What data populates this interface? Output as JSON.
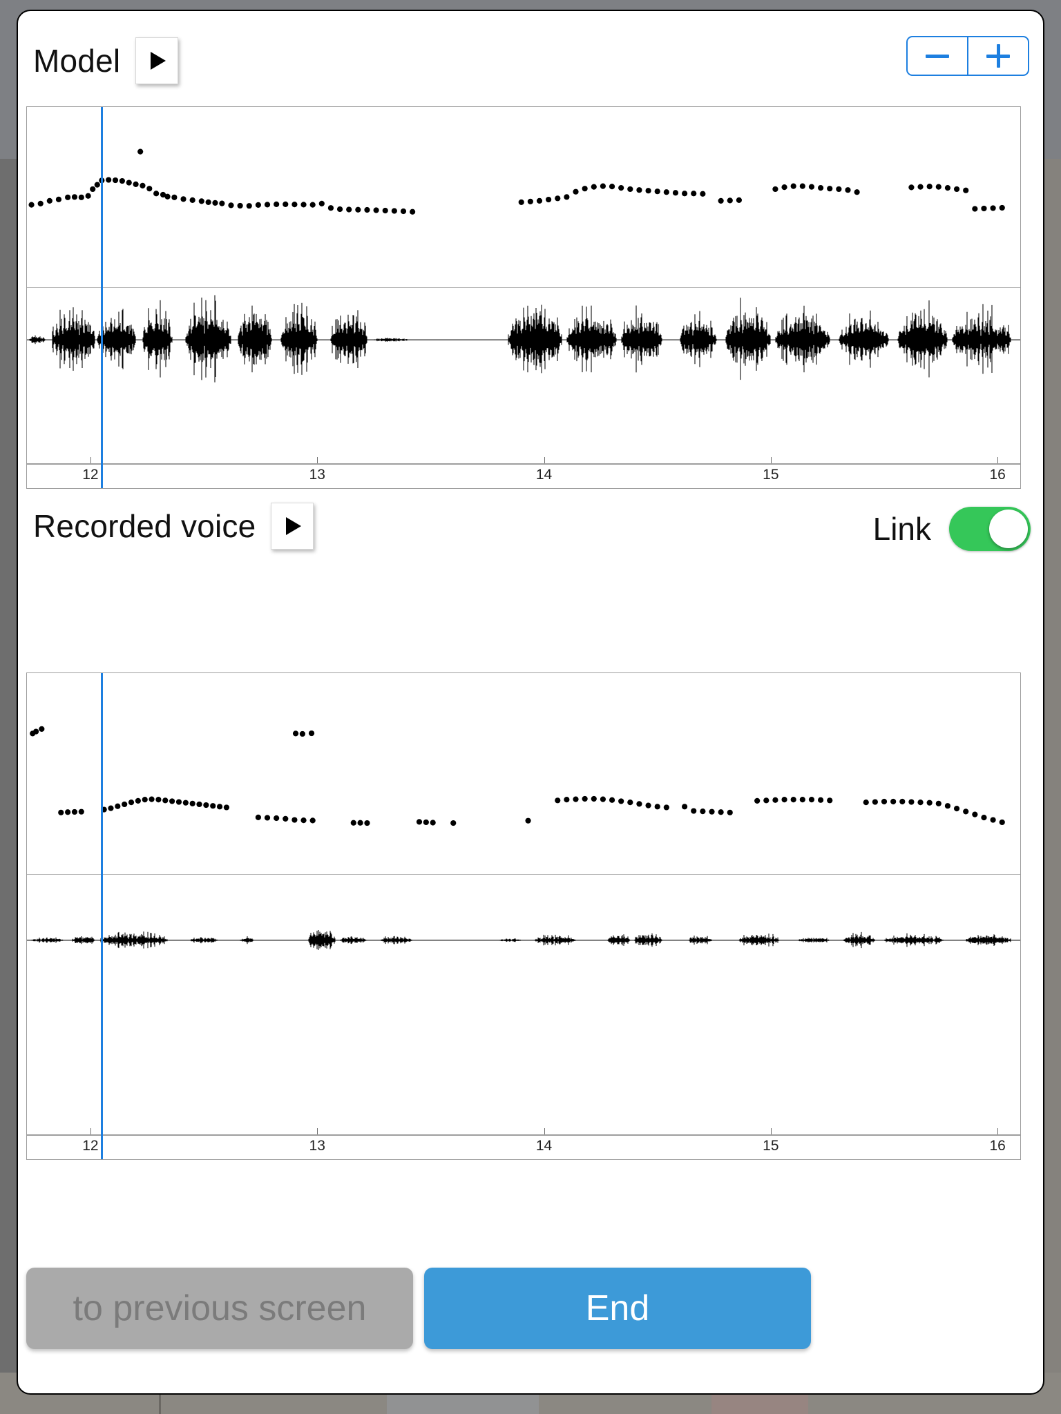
{
  "dialog": {
    "title_model": "Model",
    "title_recorded": "Recorded voice"
  },
  "stepper": {
    "decrease_label": "−",
    "increase_label": "+",
    "accent": "#1d7fe0"
  },
  "link_toggle": {
    "label": "Link",
    "state": "on",
    "on_color": "#35c759"
  },
  "play_buttons": {
    "model_label": "▶",
    "recorded_label": "▶"
  },
  "footer": {
    "previous_label": "to previous screen",
    "previous_enabled": false,
    "previous_color": "#aaaaaa",
    "end_label": "End",
    "end_color": "#3d9ad8"
  },
  "chart_data": [
    {
      "id": "model",
      "type": "scatter",
      "title": "Model",
      "xlabel": "",
      "ylabel": "",
      "xlim": [
        11.72,
        16.1
      ],
      "ylim": [
        0,
        1
      ],
      "grid": false,
      "legend": "none",
      "xticks": [
        12,
        13,
        14,
        15,
        16
      ],
      "xticklabels": [
        "12",
        "13",
        "14",
        "15",
        "16"
      ],
      "cursor_x": 12.05,
      "pitch": {
        "name": "pitch contour",
        "x": [
          11.74,
          11.78,
          11.82,
          11.86,
          11.9,
          11.93,
          11.96,
          11.99,
          12.01,
          12.03,
          12.05,
          12.08,
          12.11,
          12.14,
          12.17,
          12.2,
          12.23,
          12.26,
          12.29,
          12.32,
          12.34,
          12.37,
          12.41,
          12.45,
          12.49,
          12.52,
          12.55,
          12.58,
          12.62,
          12.66,
          12.7,
          12.74,
          12.78,
          12.82,
          12.86,
          12.9,
          12.94,
          12.98,
          13.02,
          13.06,
          13.1,
          13.14,
          13.18,
          13.22,
          13.26,
          13.3,
          13.34,
          13.38,
          13.42,
          13.9,
          13.94,
          13.98,
          14.02,
          14.06,
          14.1,
          14.14,
          14.18,
          14.22,
          14.26,
          14.3,
          14.34,
          14.38,
          14.42,
          14.46,
          14.5,
          14.54,
          14.58,
          14.62,
          14.66,
          14.7,
          14.78,
          14.82,
          14.86,
          15.02,
          15.06,
          15.1,
          15.14,
          15.18,
          15.22,
          15.26,
          15.3,
          15.34,
          15.38,
          15.62,
          15.66,
          15.7,
          15.74,
          15.78,
          15.82,
          15.86,
          15.9,
          15.94,
          15.98,
          16.02
        ],
        "y": [
          0.455,
          0.462,
          0.478,
          0.486,
          0.498,
          0.5,
          0.498,
          0.506,
          0.545,
          0.57,
          0.595,
          0.598,
          0.596,
          0.592,
          0.582,
          0.573,
          0.565,
          0.548,
          0.52,
          0.513,
          0.502,
          0.498,
          0.488,
          0.482,
          0.476,
          0.47,
          0.466,
          0.463,
          0.452,
          0.45,
          0.449,
          0.454,
          0.456,
          0.458,
          0.458,
          0.457,
          0.456,
          0.455,
          0.462,
          0.437,
          0.43,
          0.428,
          0.427,
          0.426,
          0.424,
          0.422,
          0.42,
          0.418,
          0.415,
          0.47,
          0.474,
          0.478,
          0.485,
          0.492,
          0.5,
          0.53,
          0.548,
          0.558,
          0.562,
          0.56,
          0.552,
          0.545,
          0.54,
          0.536,
          0.532,
          0.528,
          0.524,
          0.52,
          0.52,
          0.518,
          0.478,
          0.48,
          0.482,
          0.545,
          0.556,
          0.562,
          0.562,
          0.558,
          0.552,
          0.548,
          0.545,
          0.54,
          0.528,
          0.555,
          0.558,
          0.56,
          0.558,
          0.552,
          0.545,
          0.538,
          0.432,
          0.434,
          0.436,
          0.438
        ],
        "outliers_x": [
          12.22
        ],
        "outliers_y": [
          0.76
        ]
      },
      "waveform": {
        "name": "speech waveform",
        "seed": 17,
        "segments": [
          {
            "start": 11.73,
            "end": 11.8,
            "amp": 0.1
          },
          {
            "start": 11.83,
            "end": 12.02,
            "amp": 0.72
          },
          {
            "start": 12.03,
            "end": 12.2,
            "amp": 0.58
          },
          {
            "start": 12.23,
            "end": 12.36,
            "amp": 0.66
          },
          {
            "start": 12.42,
            "end": 12.62,
            "amp": 0.8
          },
          {
            "start": 12.65,
            "end": 12.8,
            "amp": 0.62
          },
          {
            "start": 12.84,
            "end": 13.0,
            "amp": 0.68
          },
          {
            "start": 13.06,
            "end": 13.22,
            "amp": 0.66
          },
          {
            "start": 13.25,
            "end": 13.4,
            "amp": 0.05
          },
          {
            "start": 13.84,
            "end": 14.08,
            "amp": 0.74
          },
          {
            "start": 14.1,
            "end": 14.32,
            "amp": 0.6
          },
          {
            "start": 14.34,
            "end": 14.52,
            "amp": 0.62
          },
          {
            "start": 14.6,
            "end": 14.76,
            "amp": 0.52
          },
          {
            "start": 14.8,
            "end": 15.0,
            "amp": 0.7
          },
          {
            "start": 15.02,
            "end": 15.26,
            "amp": 0.56
          },
          {
            "start": 15.3,
            "end": 15.52,
            "amp": 0.52
          },
          {
            "start": 15.56,
            "end": 15.78,
            "amp": 0.68
          },
          {
            "start": 15.8,
            "end": 16.06,
            "amp": 0.6
          }
        ]
      }
    },
    {
      "id": "recorded",
      "type": "scatter",
      "title": "Recorded voice",
      "xlabel": "",
      "ylabel": "",
      "xlim": [
        11.72,
        16.1
      ],
      "ylim": [
        0,
        1
      ],
      "grid": false,
      "legend": "none",
      "xticks": [
        12,
        13,
        14,
        15,
        16
      ],
      "xticklabels": [
        "12",
        "13",
        "14",
        "15",
        "16"
      ],
      "cursor_x": 12.05,
      "pitch": {
        "name": "pitch contour",
        "x": [
          12.06,
          12.09,
          12.12,
          12.15,
          12.18,
          12.21,
          12.24,
          12.27,
          12.3,
          12.33,
          12.36,
          12.39,
          12.42,
          12.45,
          12.48,
          12.51,
          12.54,
          12.57,
          12.6,
          11.87,
          11.9,
          11.93,
          11.96,
          12.74,
          12.78,
          12.82,
          12.86,
          12.9,
          12.94,
          12.98,
          13.16,
          13.19,
          13.22,
          13.45,
          13.48,
          13.51,
          13.6,
          14.06,
          14.1,
          14.14,
          14.18,
          14.22,
          14.26,
          14.3,
          14.34,
          14.38,
          14.42,
          14.46,
          14.5,
          14.54,
          14.62,
          14.66,
          14.7,
          14.74,
          14.78,
          14.82,
          14.94,
          14.98,
          15.02,
          15.06,
          15.1,
          15.14,
          15.18,
          15.22,
          15.26,
          15.42,
          15.46,
          15.5,
          15.54,
          15.58,
          15.62,
          15.66,
          15.7,
          15.74,
          15.78,
          15.82,
          15.86,
          15.9,
          15.94,
          15.98,
          16.02
        ],
        "y": [
          0.315,
          0.322,
          0.332,
          0.342,
          0.352,
          0.36,
          0.366,
          0.368,
          0.366,
          0.362,
          0.358,
          0.354,
          0.35,
          0.346,
          0.342,
          0.338,
          0.334,
          0.33,
          0.326,
          0.3,
          0.302,
          0.303,
          0.304,
          0.275,
          0.273,
          0.271,
          0.268,
          0.262,
          0.26,
          0.259,
          0.247,
          0.247,
          0.246,
          0.252,
          0.25,
          0.248,
          0.246,
          0.362,
          0.366,
          0.368,
          0.37,
          0.37,
          0.368,
          0.364,
          0.358,
          0.352,
          0.344,
          0.336,
          0.33,
          0.326,
          0.33,
          0.308,
          0.306,
          0.304,
          0.302,
          0.3,
          0.36,
          0.362,
          0.364,
          0.366,
          0.366,
          0.366,
          0.366,
          0.364,
          0.362,
          0.352,
          0.354,
          0.356,
          0.356,
          0.356,
          0.354,
          0.352,
          0.35,
          0.346,
          0.334,
          0.32,
          0.305,
          0.29,
          0.274,
          0.262,
          0.25
        ],
        "outliers_x": [
          11.745,
          11.76,
          11.785,
          12.905,
          12.935,
          12.975,
          13.93
        ],
        "outliers_y": [
          0.705,
          0.715,
          0.728,
          0.705,
          0.703,
          0.706,
          0.258
        ]
      },
      "waveform": {
        "name": "speech waveform",
        "seed": 43,
        "segments": [
          {
            "start": 11.74,
            "end": 11.88,
            "amp": 0.1
          },
          {
            "start": 11.92,
            "end": 12.02,
            "amp": 0.16
          },
          {
            "start": 12.04,
            "end": 12.34,
            "amp": 0.26
          },
          {
            "start": 12.44,
            "end": 12.56,
            "amp": 0.12
          },
          {
            "start": 12.66,
            "end": 12.72,
            "amp": 0.1
          },
          {
            "start": 12.96,
            "end": 13.08,
            "amp": 0.46
          },
          {
            "start": 13.1,
            "end": 13.22,
            "amp": 0.14
          },
          {
            "start": 13.28,
            "end": 13.42,
            "amp": 0.13
          },
          {
            "start": 13.8,
            "end": 13.9,
            "amp": 0.06
          },
          {
            "start": 13.96,
            "end": 14.14,
            "amp": 0.18
          },
          {
            "start": 14.28,
            "end": 14.38,
            "amp": 0.2
          },
          {
            "start": 14.4,
            "end": 14.52,
            "amp": 0.24
          },
          {
            "start": 14.64,
            "end": 14.74,
            "amp": 0.16
          },
          {
            "start": 14.86,
            "end": 15.04,
            "amp": 0.2
          },
          {
            "start": 15.12,
            "end": 15.26,
            "amp": 0.1
          },
          {
            "start": 15.32,
            "end": 15.46,
            "amp": 0.22
          },
          {
            "start": 15.5,
            "end": 15.76,
            "amp": 0.18
          },
          {
            "start": 15.86,
            "end": 16.06,
            "amp": 0.2
          }
        ]
      }
    }
  ]
}
